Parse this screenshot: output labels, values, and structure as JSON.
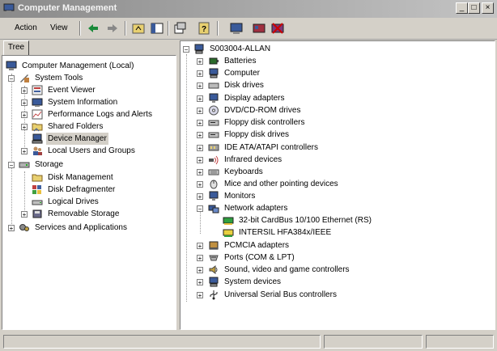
{
  "window": {
    "title": "Computer Management"
  },
  "window_controls": {
    "minimize": "_",
    "maximize": "□",
    "close": "×"
  },
  "menu": {
    "action": "Action",
    "view": "View"
  },
  "tabs": {
    "tree": "Tree"
  },
  "tree": {
    "root": "Computer Management (Local)",
    "system_tools": "System Tools",
    "event_viewer": "Event Viewer",
    "system_information": "System Information",
    "performance_logs": "Performance Logs and Alerts",
    "shared_folders": "Shared Folders",
    "device_manager": "Device Manager",
    "local_users": "Local Users and Groups",
    "storage": "Storage",
    "disk_management": "Disk Management",
    "disk_defragmenter": "Disk Defragmenter",
    "logical_drives": "Logical Drives",
    "removable_storage": "Removable Storage",
    "services": "Services and Applications"
  },
  "devices": {
    "computer_name": "S003004-ALLAN",
    "batteries": "Batteries",
    "computer": "Computer",
    "disk_drives": "Disk drives",
    "display_adapters": "Display adapters",
    "dvd_cdrom": "DVD/CD-ROM drives",
    "floppy_controllers": "Floppy disk controllers",
    "floppy_drives": "Floppy disk drives",
    "ide": "IDE ATA/ATAPI controllers",
    "infrared": "Infrared devices",
    "keyboards": "Keyboards",
    "mice": "Mice and other pointing devices",
    "monitors": "Monitors",
    "network_adapters": "Network adapters",
    "net_cardbus": "32-bit CardBus 10/100 Ethernet (RS)",
    "net_intersil": "INTERSIL HFA384x/IEEE",
    "pcmcia": "PCMCIA adapters",
    "ports": "Ports (COM & LPT)",
    "sound": "Sound, video and game controllers",
    "system_devices": "System devices",
    "usb": "Universal Serial Bus controllers"
  },
  "colors": {
    "title_start": "#8a8a8a",
    "title_end": "#c4c4c4",
    "face": "#d4d0c8"
  }
}
